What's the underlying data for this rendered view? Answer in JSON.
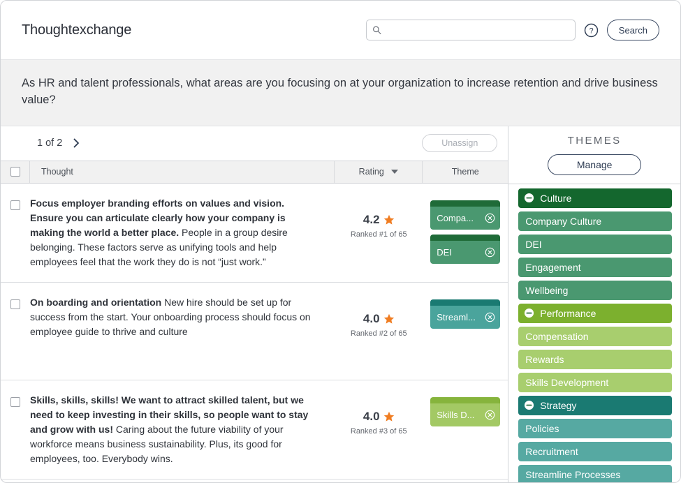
{
  "header": {
    "brand": "Thoughtexchange",
    "search_value": "",
    "search_placeholder": "",
    "search_button": "Search",
    "help_icon": "question-circle-icon",
    "search_icon": "search-icon"
  },
  "question": {
    "text": "As HR and talent professionals, what areas are you focusing on at your organization to increase retention and drive business value?"
  },
  "toolbar": {
    "pager_label": "1 of 2",
    "next_icon": "chevron-right-icon",
    "unassign_label": "Unassign"
  },
  "table": {
    "columns": {
      "select": "",
      "thought": "Thought",
      "rating": "Rating",
      "theme": "Theme"
    },
    "sort_icon": "sort-descending-caret-icon",
    "rows": [
      {
        "thought_bold": "Focus employer branding efforts on values and vision. Ensure you can articulate clearly how your company is making the world a better place.",
        "thought_rest": " People in a group desire belonging. These factors serve as unifying tools and help employees feel that the work they do is not “just work.”",
        "rating": "4.2",
        "rank": "Ranked #1 of 65",
        "themes": [
          {
            "label": "Compa...",
            "full": "Company Culture",
            "color": "#4a9870",
            "top_color": "#1f6b38"
          },
          {
            "label": "DEI",
            "full": "DEI",
            "color": "#4a9870",
            "top_color": "#1f6b38"
          }
        ]
      },
      {
        "thought_bold": "On boarding and orientation",
        "thought_rest": " New hire should be set up for success from the start. Your onboarding process should focus on employee guide to thrive and culture",
        "rating": "4.0",
        "rank": "Ranked #2 of 65",
        "themes": [
          {
            "label": "Streaml...",
            "full": "Streamline Processes",
            "color": "#4aa49c",
            "top_color": "#1a7a72"
          }
        ]
      },
      {
        "thought_bold": "Skills, skills, skills! We want to attract skilled talent, but we need to keep investing in their skills, so people want to stay and grow with us!",
        "thought_rest": " Caring about the future viability of your workforce means business sustainability. Plus, its good for employees, too. Everybody wins.",
        "rating": "4.0",
        "rank": "Ranked #3 of 65",
        "themes": [
          {
            "label": "Skills D...",
            "full": "Skills Development",
            "color": "#a3c964",
            "top_color": "#86b43c"
          }
        ]
      }
    ]
  },
  "themes_panel": {
    "title": "THEMES",
    "manage_label": "Manage",
    "collapse_icon": "minus-circle-icon",
    "groups": [
      {
        "label": "Culture",
        "color": "#14672e",
        "child_color": "#4a9870",
        "children": [
          {
            "label": "Company Culture"
          },
          {
            "label": "DEI"
          },
          {
            "label": "Engagement"
          },
          {
            "label": "Wellbeing"
          }
        ]
      },
      {
        "label": "Performance",
        "color": "#7cb02e",
        "child_color": "#a8ce6e",
        "children": [
          {
            "label": "Compensation"
          },
          {
            "label": "Rewards"
          },
          {
            "label": "Skills Development"
          }
        ]
      },
      {
        "label": "Strategy",
        "color": "#1a7a72",
        "child_color": "#56a9a2",
        "children": [
          {
            "label": "Policies"
          },
          {
            "label": "Recruitment"
          },
          {
            "label": "Streamline Processes"
          }
        ]
      }
    ]
  },
  "colors": {
    "star": "#f07d22",
    "accent_navy": "#2d3b52",
    "banner_bg": "#f1f1f1"
  }
}
